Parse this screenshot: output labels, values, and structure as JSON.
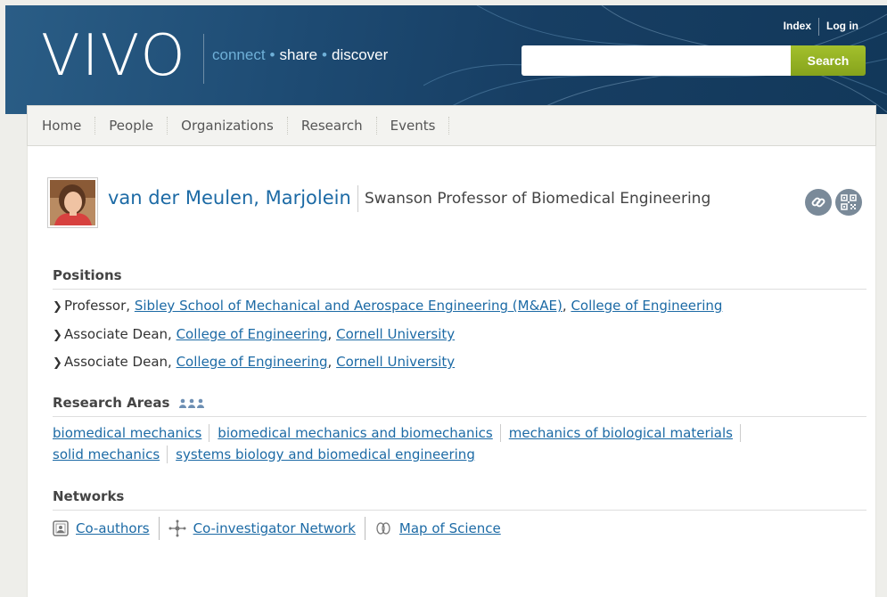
{
  "header": {
    "logo": "VIVO",
    "tagline": {
      "connect": "connect",
      "share": "share",
      "discover": "discover",
      "separator": "•"
    },
    "top_links": [
      "Index",
      "Log in"
    ],
    "search": {
      "placeholder": "",
      "button_label": "Search"
    },
    "colors": {
      "banner": "#1d4a72",
      "accent": "#6fb0d8",
      "search_button": "#94b224"
    }
  },
  "nav": {
    "items": [
      "Home",
      "People",
      "Organizations",
      "Research",
      "Events"
    ]
  },
  "profile": {
    "name": "van der Meulen, Marjolein",
    "title": "Swanson Professor of Biomedical Engineering",
    "icons": [
      "link-icon",
      "qr-code-icon"
    ]
  },
  "positions": {
    "heading": "Positions",
    "items": [
      {
        "role": "Professor",
        "links": [
          "Sibley School of Mechanical and Aerospace Engineering (M&AE)",
          "College of Engineering"
        ]
      },
      {
        "role": "Associate Dean",
        "links": [
          "College of Engineering",
          "Cornell University"
        ]
      },
      {
        "role": "Associate Dean",
        "links": [
          "College of Engineering",
          "Cornell University"
        ]
      }
    ]
  },
  "research_areas": {
    "heading": "Research Areas",
    "icon": "people-group-icon",
    "items": [
      "biomedical mechanics",
      "biomedical mechanics and biomechanics",
      "mechanics of biological materials",
      "solid mechanics",
      "systems biology and biomedical engineering"
    ]
  },
  "networks": {
    "heading": "Networks",
    "items": [
      {
        "label": "Co-authors",
        "icon": "coauthors-icon"
      },
      {
        "label": "Co-investigator Network",
        "icon": "network-icon"
      },
      {
        "label": "Map of Science",
        "icon": "map-of-science-icon"
      }
    ]
  }
}
